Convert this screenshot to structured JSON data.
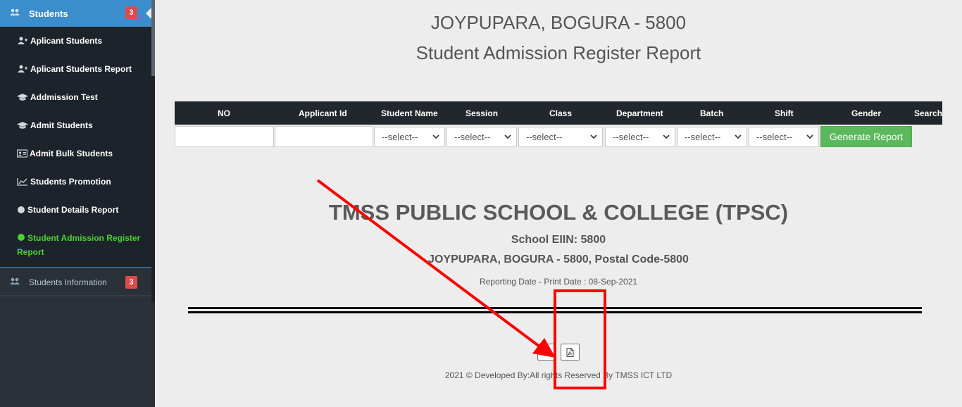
{
  "sidebar": {
    "header": {
      "label": "Students",
      "badge": "3"
    },
    "items": [
      {
        "label": "Aplicant Students"
      },
      {
        "label": "Aplicant Students Report"
      },
      {
        "label": "Addmission Test"
      },
      {
        "label": "Admit Students"
      },
      {
        "label": "Admit Bulk Students"
      },
      {
        "label": "Students Promotion"
      },
      {
        "label": "Student Details Report"
      },
      {
        "label": "Student Admission Register Report"
      }
    ],
    "info": {
      "label": "Students Information",
      "badge": "3"
    }
  },
  "page": {
    "address": "JOYPUPARA, BOGURA - 5800",
    "title": "Student Admission Register Report"
  },
  "table": {
    "columns": [
      "NO",
      "Applicant Id",
      "Student Name",
      "Session",
      "Class",
      "Department",
      "Batch",
      "Shift",
      "Gender",
      "Search"
    ]
  },
  "filters": {
    "select_placeholder": "--select--",
    "generate_label": "Generate Report"
  },
  "report": {
    "school": "TMSS PUBLIC SCHOOL & COLLEGE (TPSC)",
    "eiin": "School EIIN: 5800",
    "address": "JOYPUPARA, BOGURA - 5800, Postal Code-5800",
    "reporting_date": "Reporting Date - Print Date : 08-Sep-2021"
  },
  "footer": {
    "text": "2021 © Developed By:All rights Reserved By TMSS ICT LTD"
  },
  "colors": {
    "accent": "#3c8dcb",
    "annotation": "#ff0000",
    "success": "#5cb85c",
    "active": "#4cd137"
  }
}
